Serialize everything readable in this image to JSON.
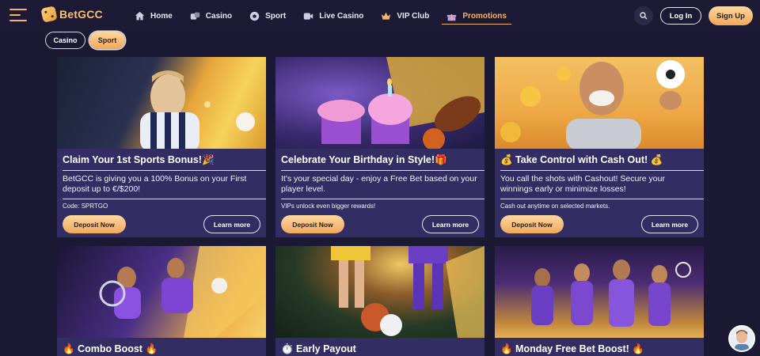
{
  "header": {
    "logo": "BetGCC",
    "nav": [
      {
        "label": "Home",
        "icon": "home-icon"
      },
      {
        "label": "Casino",
        "icon": "dice-icon"
      },
      {
        "label": "Sport",
        "icon": "soccer-ball-icon"
      },
      {
        "label": "Live Casino",
        "icon": "video-icon"
      },
      {
        "label": "VIP Club",
        "icon": "crown-icon"
      },
      {
        "label": "Promotions",
        "icon": "gift-icon",
        "active": true
      }
    ],
    "login_label": "Log In",
    "signup_label": "Sign Up"
  },
  "filters": [
    {
      "label": "Casino",
      "selected": false
    },
    {
      "label": "Sport",
      "selected": true
    }
  ],
  "cards": [
    {
      "title": "Claim Your 1st Sports Bonus!🎉",
      "description": "BetGCC is giving you a 100% Bonus on your First deposit up to €/$200!",
      "note": "Code: SPRTGO",
      "deposit_label": "Deposit Now",
      "learn_label": "Learn more"
    },
    {
      "title": "Celebrate Your Birthday in Style!🎁",
      "description": "It's your special day - enjoy a Free Bet based on your player level.",
      "note": "VIPs unlock even bigger rewards!",
      "deposit_label": "Deposit Now",
      "learn_label": "Learn more"
    },
    {
      "title": "💰 Take Control with Cash Out! 💰",
      "description": "You call the shots with Cashout! Secure your winnings early or minimize losses!",
      "note": "Cash out anytime on selected markets.",
      "deposit_label": "Deposit Now",
      "learn_label": "Learn more"
    },
    {
      "title": "🔥 Combo Boost 🔥"
    },
    {
      "title": "⏱️ Early Payout"
    },
    {
      "title": "🔥 Monday Free Bet Boost! 🔥"
    }
  ],
  "colors": {
    "background": "#1b1933",
    "card": "#322e63",
    "accent": "#f2b66a"
  }
}
